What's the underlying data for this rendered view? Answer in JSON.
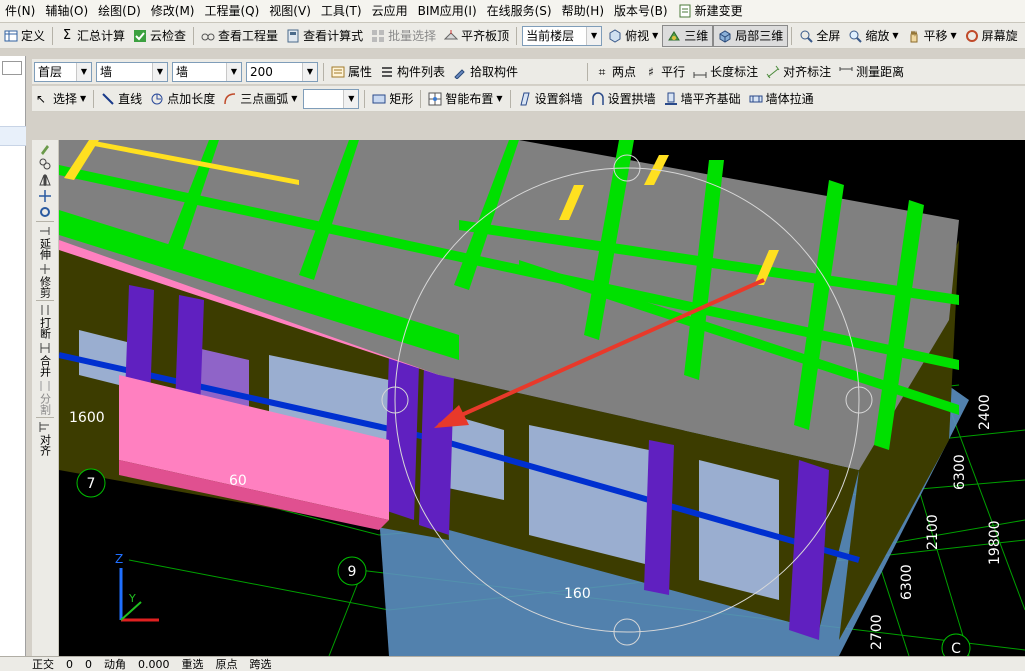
{
  "menu": [
    "件(N)",
    "辅轴(O)",
    "绘图(D)",
    "修改(M)",
    "工程量(Q)",
    "视图(V)",
    "工具(T)",
    "云应用",
    "BIM应用(I)",
    "在线服务(S)",
    "帮助(H)",
    "版本号(B)"
  ],
  "menu_extra": "新建变更",
  "toolbar1": {
    "define": "定义",
    "summary": "汇总计算",
    "cloud_check": "云检查",
    "view_quantity": "查看工程量",
    "view_formula": "查看计算式",
    "batch_select": "批量选择",
    "align_slab": "平齐板顶",
    "floor_combo": "当前楼层",
    "top_view": "俯视",
    "three_d": "三维",
    "local_3d": "局部三维",
    "fullscreen": "全屏",
    "zoom": "缩放",
    "pan": "平移",
    "screen_rotate": "屏幕旋"
  },
  "toolbar2": {
    "floor": "首层",
    "type1": "墙",
    "type2": "墙",
    "size": "200",
    "properties": "属性",
    "component_list": "构件列表",
    "pick": "拾取构件",
    "two_points": "两点",
    "parallel": "平行",
    "length_dim": "长度标注",
    "align_dim": "对齐标注",
    "measure": "测量距离"
  },
  "toolbar3": {
    "select": "选择",
    "line": "直线",
    "point_length": "点加长度",
    "arc": "三点画弧",
    "rect": "矩形",
    "smart": "智能布置",
    "slope_wall": "设置斜墙",
    "arch_wall": "设置拱墙",
    "wall_align": "墙平齐基础",
    "wall_pull": "墙体拉通"
  },
  "vtool": {
    "extend": "延伸",
    "trim": "修剪",
    "break": "打断",
    "merge": "合并",
    "split": "分割",
    "align": "对齐"
  },
  "viewport": {
    "axis_labels": [
      "7",
      "9",
      "C"
    ],
    "dims": [
      "1600",
      "60",
      "160",
      "2400",
      "6300",
      "2100",
      "19800",
      "6300",
      "2700"
    ],
    "axis_z": "Z",
    "axis_y": "Y"
  },
  "colors": {
    "beam_green": "#00e000",
    "slab_gray": "#808080",
    "wall_pink": "#ff80c0",
    "column_purple": "#6020c0",
    "arrow_red": "#e8392a",
    "olive": "#3c3c00"
  },
  "status_items": [
    "正交",
    "0",
    "0",
    "动角",
    "0.000",
    "重选",
    "原点",
    "跨选"
  ]
}
